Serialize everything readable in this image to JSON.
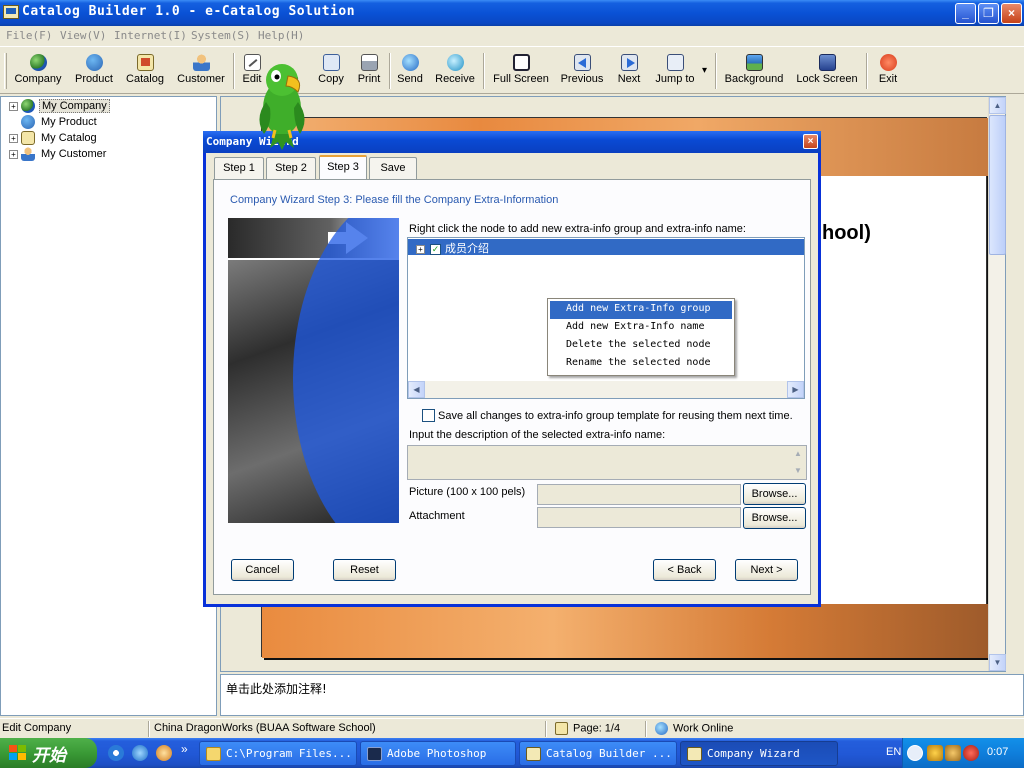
{
  "window": {
    "title": "Catalog Builder 1.0 - e-Catalog Solution",
    "min_glyph": "_",
    "max_glyph": "❐",
    "close_glyph": "×"
  },
  "menu": [
    "File(F)",
    "View(V)",
    "Internet(I)",
    "System(S)",
    "Help(H)"
  ],
  "toolbar": {
    "company": "Company",
    "product": "Product",
    "catalog": "Catalog",
    "customer": "Customer",
    "edit": "Edit",
    "delete": "te",
    "copy": "Copy",
    "print": "Print",
    "send": "Send",
    "receive": "Receive",
    "fullscreen": "Full Screen",
    "previous": "Previous",
    "next": "Next",
    "jumpto": "Jump to",
    "jump_arrow": "▾",
    "background": "Background",
    "lockscreen": "Lock Screen",
    "exit": "Exit"
  },
  "tree": {
    "expand_glyph": "+",
    "items": [
      "My Company",
      "My Product",
      "My Catalog",
      "My Customer"
    ]
  },
  "preview": {
    "headline": "hool)",
    "scroll_up": "▲",
    "scroll_down": "▼"
  },
  "annotation": "单击此处添加注释!",
  "status": {
    "action": "Edit Company",
    "company": "China DragonWorks (BUAA Software School)",
    "page": "Page: 1/4",
    "mode": "Work Online"
  },
  "taskbar": {
    "start": "开始",
    "more": "»",
    "tasks": [
      "C:\\Program Files...",
      "Adobe Photoshop",
      "Catalog Builder ...",
      "Company Wizard"
    ],
    "lang": "EN",
    "time": "0:07"
  },
  "dialog": {
    "title": "Company Wizard",
    "close_glyph": "×",
    "tabs": [
      "Step 1",
      "Step 2",
      "Step 3",
      "Save"
    ],
    "caption": "Company Wizard Step 3: Please fill the Company Extra-Information",
    "instruction": "Right click the node to add new extra-info group and extra-info name:",
    "node": {
      "expand": "+",
      "check": "✓",
      "label": "成员介绍"
    },
    "hscroll_left": "◀",
    "hscroll_right": "▶",
    "context_menu": [
      "Add new Extra-Info group",
      "Add new Extra-Info name",
      "Delete the selected node",
      "Rename the selected node"
    ],
    "save_template": "Save all changes to extra-info group template for reusing them next time.",
    "desc_label": "Input the description of the selected extra-info name:",
    "desc_up": "▲",
    "desc_down": "▼",
    "picture_label": "Picture (100 x 100 pels)",
    "attachment_label": "Attachment",
    "browse": "Browse...",
    "buttons": {
      "cancel": "Cancel",
      "reset": "Reset",
      "back": "< Back",
      "next": "Next >"
    }
  }
}
